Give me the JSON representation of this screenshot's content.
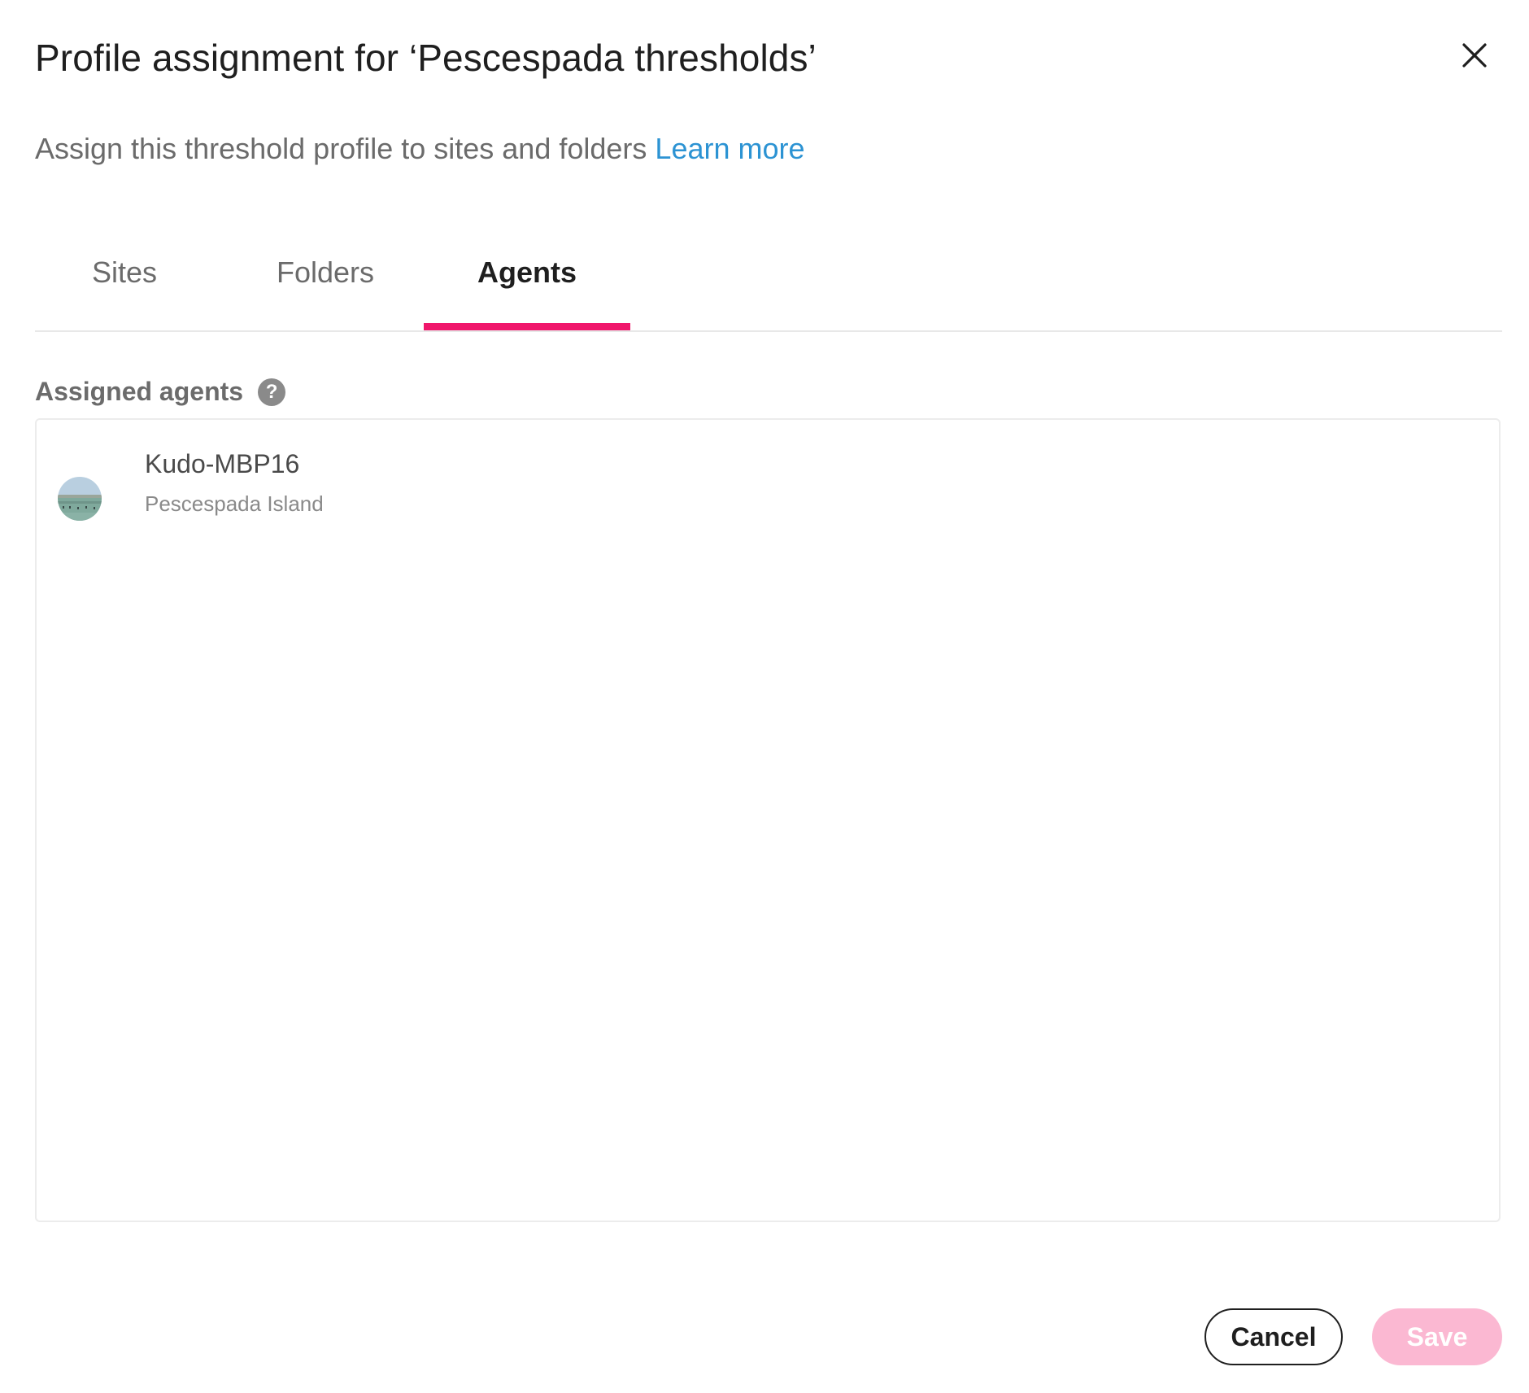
{
  "dialog": {
    "title": "Profile assignment for ‘Pescespada thresholds’",
    "subtitle": "Assign this threshold profile to sites and folders",
    "learn_more": "Learn more",
    "close_icon": "close-icon"
  },
  "tabs": [
    {
      "label": "Sites",
      "active": false
    },
    {
      "label": "Folders",
      "active": false
    },
    {
      "label": "Agents",
      "active": true
    }
  ],
  "section": {
    "label": "Assigned agents",
    "help_icon": "question-mark-icon"
  },
  "agents": [
    {
      "name": "Kudo-MBP16",
      "location": "Pescespada Island",
      "avatar": "island-photo-avatar"
    }
  ],
  "footer": {
    "cancel_label": "Cancel",
    "save_label": "Save"
  },
  "colors": {
    "accent": "#f0166b",
    "link": "#2c93d3",
    "save_disabled": "#fbb8d2"
  }
}
